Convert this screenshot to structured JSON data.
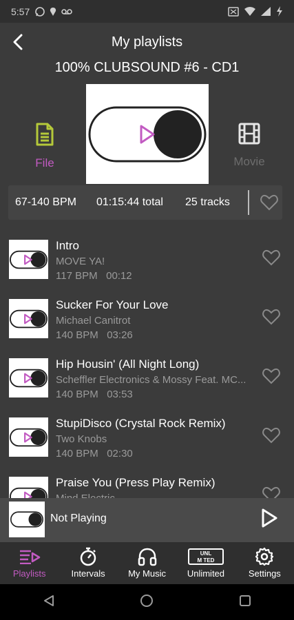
{
  "status": {
    "time": "5:57"
  },
  "header": {
    "title": "My playlists"
  },
  "playlist": {
    "name": "100% CLUBSOUND #6 - CD1",
    "file_label": "File",
    "movie_label": "Movie",
    "bpm_range": "67-140 BPM",
    "total": "01:15:44 total",
    "tracks": "25 tracks"
  },
  "tracks": [
    {
      "title": "Intro",
      "artist": "MOVE YA!",
      "bpm": "117 BPM",
      "duration": "00:12"
    },
    {
      "title": "Sucker For Your Love",
      "artist": "Michael Canitrot",
      "bpm": "140 BPM",
      "duration": "03:26"
    },
    {
      "title": "Hip Housin' (All Night Long)",
      "artist": "Scheffler Electronics & Mossy Feat. MC...",
      "bpm": "140 BPM",
      "duration": "03:53"
    },
    {
      "title": "StupiDisco (Crystal Rock Remix)",
      "artist": "Two Knobs",
      "bpm": "140 BPM",
      "duration": "02:30"
    },
    {
      "title": "Praise You (Press Play Remix)",
      "artist": "Mind Electric",
      "bpm": "",
      "duration": ""
    }
  ],
  "player": {
    "status": "Not Playing"
  },
  "tabs": [
    {
      "label": "Playlists",
      "icon": "playlist-icon",
      "active": true
    },
    {
      "label": "Intervals",
      "icon": "stopwatch-icon",
      "active": false
    },
    {
      "label": "My Music",
      "icon": "headphones-icon",
      "active": false
    },
    {
      "label": "Unlimited",
      "icon": "unlimited-icon",
      "active": false
    },
    {
      "label": "Settings",
      "icon": "gear-icon",
      "active": false
    }
  ],
  "colors": {
    "accent": "#c25bc2",
    "file_icon": "#b5c93a",
    "background": "#3b3b3b"
  }
}
